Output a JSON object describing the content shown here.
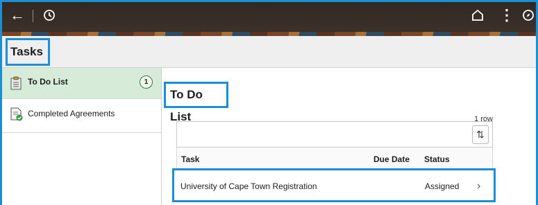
{
  "header": {
    "back_icon": "arrow-left-icon",
    "history_icon": "clock-icon",
    "home_icon": "home-icon",
    "menu_icon": "vertical-dots-icon",
    "navbar_icon": "compass-icon"
  },
  "page": {
    "title": "Tasks"
  },
  "sidebar": {
    "items": [
      {
        "label": "To Do List",
        "count": "1",
        "icon": "clipboard-icon"
      },
      {
        "label": "Completed Agreements",
        "icon": "document-check-icon"
      }
    ]
  },
  "main": {
    "title": "To Do List",
    "row_count": "1 row",
    "sort_icon": "sort-arrows-icon",
    "columns": [
      "Task",
      "Due Date",
      "Status"
    ],
    "rows": [
      {
        "task": "University of Cape Town Registration",
        "due_date": "",
        "status": "Assigned"
      }
    ]
  },
  "colors": {
    "accent_frame": "#1a8fd6",
    "active_item": "#d6ecd9",
    "banner": "#3a2f27"
  }
}
